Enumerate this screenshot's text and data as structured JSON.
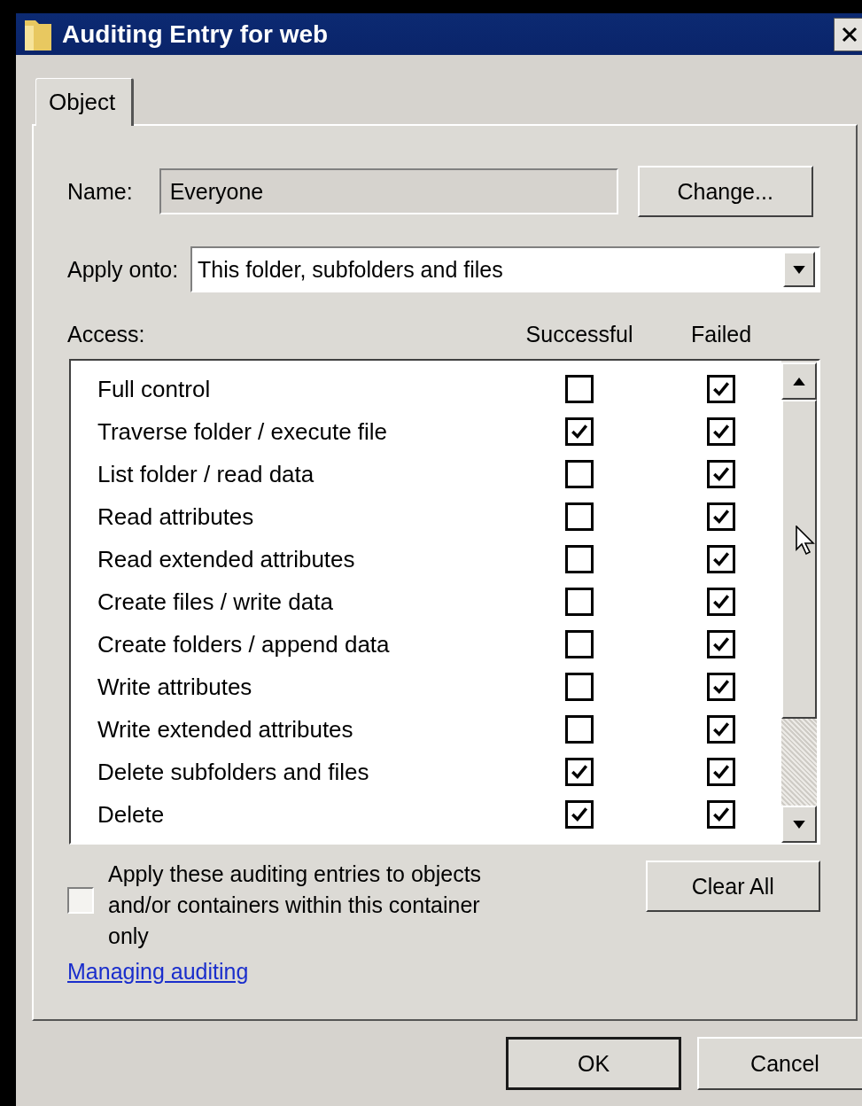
{
  "window": {
    "title": "Auditing Entry for web"
  },
  "tabs": [
    {
      "label": "Object",
      "selected": true
    }
  ],
  "name_field": {
    "label": "Name:",
    "value": "Everyone"
  },
  "change_button": "Change...",
  "apply_onto": {
    "label": "Apply onto:",
    "value": "This folder, subfolders and files"
  },
  "access": {
    "label": "Access:",
    "columns": [
      "Successful",
      "Failed"
    ],
    "rows": [
      {
        "name": "Full control",
        "successful": false,
        "failed": true
      },
      {
        "name": "Traverse folder / execute file",
        "successful": true,
        "failed": true
      },
      {
        "name": "List folder / read data",
        "successful": false,
        "failed": true
      },
      {
        "name": "Read attributes",
        "successful": false,
        "failed": true
      },
      {
        "name": "Read extended attributes",
        "successful": false,
        "failed": true
      },
      {
        "name": "Create files / write data",
        "successful": false,
        "failed": true
      },
      {
        "name": "Create folders / append data",
        "successful": false,
        "failed": true
      },
      {
        "name": "Write attributes",
        "successful": false,
        "failed": true
      },
      {
        "name": "Write extended attributes",
        "successful": false,
        "failed": true
      },
      {
        "name": "Delete subfolders and files",
        "successful": true,
        "failed": true
      },
      {
        "name": "Delete",
        "successful": true,
        "failed": true
      }
    ]
  },
  "apply_to_container_only": {
    "label": "Apply these auditing entries to objects and/or containers within this container only",
    "checked": false
  },
  "clear_all_button": "Clear All",
  "help_link": "Managing auditing",
  "buttons": [
    {
      "label": "OK",
      "default": true
    },
    {
      "label": "Cancel",
      "default": false
    }
  ]
}
